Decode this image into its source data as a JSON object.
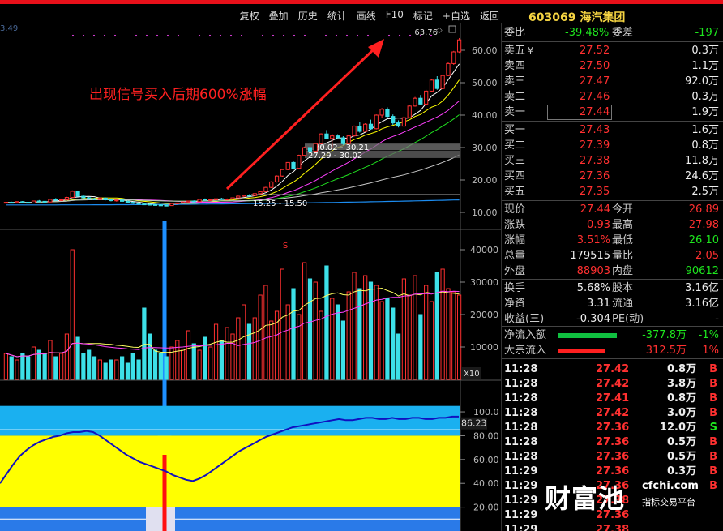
{
  "menu": [
    "复权",
    "叠加",
    "历史",
    "统计",
    "画线",
    "F10",
    "标记",
    "+自选",
    "返回"
  ],
  "stock": {
    "code": "603069",
    "name": "海汽集团"
  },
  "annotation": "出现信号买入后期600%涨幅",
  "corner_value": "3.49",
  "colors": {
    "up": "#ff3030",
    "down": "#3de0e8",
    "ma5": "#ffffff",
    "ma10": "#ffff00",
    "ma20": "#ff40ff",
    "ma30": "#20e020",
    "ma60": "#c8c8c8",
    "ma120": "#1c8cf0",
    "arrow": "#ff2020",
    "indicator_fill": "#ffff00",
    "indicator_band": "#1ab0f0"
  },
  "price_axis": [
    "60.00",
    "50.00",
    "40.00",
    "30.00",
    "20.00",
    "10.00"
  ],
  "volume_axis": [
    "40000",
    "30000",
    "20000",
    "10000"
  ],
  "volume_unit": "X10",
  "indicator_axis": [
    "100.0",
    "80.00",
    "60.00",
    "40.00",
    "20.00"
  ],
  "indicator_value": "86.23",
  "labels": {
    "high": "63.76",
    "box1": "30.02 - 30.21",
    "box2": "27.29 - 30.02",
    "low_range": "15.25 - 15.50",
    "signal": "S"
  },
  "chart_data": {
    "type": "candlestick",
    "price_ylim": [
      5,
      67
    ],
    "candles": [
      [
        13.0,
        13.2,
        12.8,
        13.1
      ],
      [
        13.1,
        13.3,
        12.9,
        13.0
      ],
      [
        13.0,
        13.4,
        12.9,
        13.3
      ],
      [
        13.3,
        13.5,
        13.0,
        13.1
      ],
      [
        13.1,
        13.2,
        12.8,
        12.9
      ],
      [
        12.9,
        13.6,
        12.9,
        13.5
      ],
      [
        13.5,
        13.8,
        13.3,
        13.4
      ],
      [
        13.4,
        13.5,
        13.0,
        13.2
      ],
      [
        13.2,
        14.2,
        13.1,
        14.0
      ],
      [
        14.0,
        14.4,
        13.6,
        13.7
      ],
      [
        13.7,
        14.0,
        13.5,
        13.9
      ],
      [
        13.9,
        14.8,
        13.8,
        14.6
      ],
      [
        14.6,
        16.8,
        14.5,
        16.5
      ],
      [
        16.5,
        16.7,
        14.8,
        15.0
      ],
      [
        15.0,
        15.4,
        14.2,
        14.5
      ],
      [
        14.5,
        14.8,
        13.9,
        14.2
      ],
      [
        14.2,
        14.5,
        13.8,
        14.0
      ],
      [
        14.0,
        14.6,
        13.9,
        14.4
      ],
      [
        14.4,
        14.6,
        13.7,
        13.9
      ],
      [
        13.9,
        14.1,
        13.4,
        13.6
      ],
      [
        13.6,
        13.9,
        13.3,
        13.8
      ],
      [
        13.8,
        14.0,
        13.2,
        13.4
      ],
      [
        13.4,
        13.6,
        12.9,
        13.1
      ],
      [
        13.1,
        13.3,
        12.6,
        12.8
      ],
      [
        12.8,
        13.0,
        12.4,
        12.6
      ],
      [
        12.6,
        12.8,
        12.3,
        12.5
      ],
      [
        12.5,
        12.7,
        12.2,
        12.4
      ],
      [
        12.4,
        12.6,
        12.1,
        12.3
      ],
      [
        12.3,
        12.5,
        12.0,
        12.2
      ],
      [
        12.2,
        12.4,
        11.9,
        12.1
      ],
      [
        12.1,
        12.8,
        12.0,
        12.7
      ],
      [
        12.7,
        13.0,
        12.5,
        12.9
      ],
      [
        12.9,
        13.3,
        12.8,
        13.2
      ],
      [
        13.2,
        13.6,
        13.0,
        13.5
      ],
      [
        13.5,
        13.7,
        13.1,
        13.3
      ],
      [
        13.3,
        14.2,
        13.2,
        14.0
      ],
      [
        14.0,
        14.3,
        13.6,
        13.8
      ],
      [
        13.8,
        14.1,
        13.5,
        13.9
      ],
      [
        13.9,
        14.4,
        13.8,
        14.2
      ],
      [
        14.2,
        14.5,
        13.9,
        14.0
      ],
      [
        14.0,
        14.3,
        13.8,
        14.1
      ],
      [
        14.1,
        14.6,
        14.0,
        14.5
      ],
      [
        14.5,
        15.2,
        14.4,
        15.0
      ],
      [
        15.0,
        15.4,
        14.8,
        15.3
      ],
      [
        15.3,
        15.6,
        15.0,
        15.2
      ],
      [
        15.2,
        15.9,
        15.1,
        15.8
      ],
      [
        15.8,
        16.6,
        15.7,
        16.4
      ],
      [
        16.4,
        17.9,
        16.3,
        17.7
      ],
      [
        17.7,
        19.6,
        17.5,
        19.4
      ],
      [
        19.4,
        21.4,
        19.2,
        21.2
      ],
      [
        21.2,
        23.4,
        21.0,
        23.2
      ],
      [
        23.2,
        25.5,
        23.0,
        25.4
      ],
      [
        25.4,
        25.8,
        23.2,
        23.6
      ],
      [
        23.6,
        27.8,
        23.5,
        27.6
      ],
      [
        27.6,
        30.3,
        27.4,
        30.0
      ],
      [
        30.0,
        30.4,
        28.6,
        28.9
      ],
      [
        28.9,
        31.4,
        28.7,
        31.2
      ],
      [
        31.2,
        34.4,
        31.0,
        34.2
      ],
      [
        34.2,
        35.4,
        32.5,
        32.8
      ],
      [
        32.8,
        34.2,
        30.0,
        33.6
      ],
      [
        33.6,
        34.1,
        32.8,
        33.0
      ],
      [
        33.0,
        33.5,
        30.8,
        31.2
      ],
      [
        31.2,
        33.8,
        31.0,
        33.6
      ],
      [
        33.6,
        36.8,
        33.4,
        36.6
      ],
      [
        36.6,
        37.8,
        34.6,
        35.0
      ],
      [
        35.0,
        37.5,
        34.8,
        37.2
      ],
      [
        37.2,
        38.6,
        35.5,
        35.8
      ],
      [
        35.8,
        40.2,
        35.6,
        40.0
      ],
      [
        40.0,
        42.2,
        39.0,
        41.8
      ],
      [
        41.8,
        42.4,
        39.0,
        39.6
      ],
      [
        39.6,
        40.2,
        37.0,
        37.6
      ],
      [
        37.6,
        38.4,
        36.2,
        36.6
      ],
      [
        36.6,
        39.6,
        36.4,
        39.2
      ],
      [
        39.2,
        43.2,
        39.0,
        42.8
      ],
      [
        42.8,
        45.6,
        42.6,
        45.2
      ],
      [
        45.2,
        46.2,
        43.0,
        43.4
      ],
      [
        43.4,
        47.8,
        43.2,
        47.4
      ],
      [
        47.4,
        51.2,
        47.0,
        50.8
      ],
      [
        50.8,
        52.0,
        47.8,
        48.2
      ],
      [
        48.2,
        52.5,
        48.0,
        52.2
      ],
      [
        52.2,
        56.3,
        52.0,
        55.9
      ],
      [
        55.9,
        59.8,
        55.5,
        59.5
      ],
      [
        59.5,
        63.76,
        59.2,
        63.2
      ]
    ],
    "volume": [
      8,
      7,
      6,
      8,
      7,
      10,
      9,
      8,
      12,
      7,
      8,
      14,
      40,
      13,
      8,
      9,
      7,
      6,
      5,
      6,
      6,
      7,
      5,
      8,
      6,
      22,
      14,
      9,
      8,
      7,
      10,
      12,
      9,
      15,
      11,
      9,
      13,
      10,
      17,
      12,
      16,
      14,
      19,
      23,
      17,
      19,
      26,
      29,
      18,
      21,
      34,
      23,
      28,
      20,
      36,
      31,
      30,
      21,
      35,
      25,
      23,
      18,
      27,
      33,
      28,
      32,
      30,
      29,
      24,
      25,
      22,
      14,
      31,
      26,
      32,
      20,
      29,
      24,
      33,
      34,
      28,
      27,
      26
    ],
    "indicator": [
      40,
      48,
      56,
      63,
      68,
      72,
      75,
      77,
      79,
      80,
      82,
      83,
      83,
      84,
      83,
      80,
      76,
      72,
      68,
      64,
      61,
      58,
      56,
      54,
      52,
      50,
      47,
      45,
      43,
      42,
      44,
      47,
      51,
      55,
      59,
      63,
      67,
      70,
      73,
      76,
      79,
      81,
      83,
      85,
      87,
      88,
      89,
      90,
      91,
      92,
      93,
      94,
      93,
      93,
      94,
      95,
      95,
      94,
      94,
      95,
      94,
      94,
      95,
      95,
      94,
      94,
      95,
      95,
      96,
      96
    ]
  },
  "quote": {
    "weibi": {
      "label": "委比",
      "value": "-39.48%",
      "label2": "委差",
      "value2": "-197"
    },
    "sells": [
      {
        "label": "卖五",
        "mark": "¥",
        "price": "27.52",
        "vol": "0.3万"
      },
      {
        "label": "卖四",
        "mark": "",
        "price": "27.50",
        "vol": "1.1万"
      },
      {
        "label": "卖三",
        "mark": "",
        "price": "27.47",
        "vol": "92.0万"
      },
      {
        "label": "卖二",
        "mark": "",
        "price": "27.46",
        "vol": "0.3万"
      },
      {
        "label": "卖一",
        "mark": "",
        "price": "27.44",
        "vol": "1.9万"
      }
    ],
    "buys": [
      {
        "label": "买一",
        "price": "27.43",
        "vol": "1.6万"
      },
      {
        "label": "买二",
        "price": "27.39",
        "vol": "0.8万"
      },
      {
        "label": "买三",
        "price": "27.38",
        "vol": "11.8万"
      },
      {
        "label": "买四",
        "price": "27.36",
        "vol": "24.6万"
      },
      {
        "label": "买五",
        "price": "27.35",
        "vol": "2.5万"
      }
    ],
    "stats": [
      {
        "l1": "现价",
        "v1": "27.44",
        "c1": "red",
        "l2": "今开",
        "v2": "26.89",
        "c2": "red"
      },
      {
        "l1": "涨跌",
        "v1": "0.93",
        "c1": "red",
        "l2": "最高",
        "v2": "27.98",
        "c2": "red"
      },
      {
        "l1": "涨幅",
        "v1": "3.51%",
        "c1": "red",
        "l2": "最低",
        "v2": "26.10",
        "c2": "green"
      },
      {
        "l1": "总量",
        "v1": "179515",
        "c1": "white",
        "l2": "量比",
        "v2": "2.05",
        "c2": "red"
      },
      {
        "l1": "外盘",
        "v1": "88903",
        "c1": "red",
        "l2": "内盘",
        "v2": "90612",
        "c2": "green"
      }
    ],
    "fin": [
      {
        "l1": "换手",
        "v1": "5.68%",
        "l2": "股本",
        "v2": "3.16亿"
      },
      {
        "l1": "净资",
        "v1": "3.31",
        "l2": "流通",
        "v2": "3.16亿"
      },
      {
        "l1": "收益(三)",
        "v1": "-0.304",
        "l2": "PE(动)",
        "v2": "-"
      }
    ],
    "flow": [
      {
        "label": "净流入额",
        "value": "-377.8万",
        "pct": "-1%",
        "color": "green"
      },
      {
        "label": "大宗流入",
        "value": "312.5万",
        "pct": "1%",
        "color": "red"
      }
    ]
  },
  "ticks": [
    {
      "t": "11:28",
      "p": "27.42",
      "v": "0.8万",
      "s": "B"
    },
    {
      "t": "11:28",
      "p": "27.42",
      "v": "3.8万",
      "s": "B"
    },
    {
      "t": "11:28",
      "p": "27.41",
      "v": "0.8万",
      "s": "B"
    },
    {
      "t": "11:28",
      "p": "27.42",
      "v": "3.0万",
      "s": "B"
    },
    {
      "t": "11:28",
      "p": "27.36",
      "v": "12.0万",
      "s": "S"
    },
    {
      "t": "11:28",
      "p": "27.36",
      "v": "0.5万",
      "s": "B"
    },
    {
      "t": "11:28",
      "p": "27.36",
      "v": "0.5万",
      "s": "B"
    },
    {
      "t": "11:29",
      "p": "27.36",
      "v": "0.3万",
      "s": "B"
    },
    {
      "t": "11:29",
      "p": "27.36",
      "v": "",
      "s": "B"
    },
    {
      "t": "11:29",
      "p": "27.38",
      "v": "",
      "s": ""
    },
    {
      "t": "11:29",
      "p": "27.36",
      "v": "",
      "s": ""
    },
    {
      "t": "11:29",
      "p": "27.38",
      "v": "",
      "s": ""
    }
  ],
  "watermark": {
    "name": "财富池",
    "url": "cfchi.com",
    "slogan": "指标交易平台"
  }
}
